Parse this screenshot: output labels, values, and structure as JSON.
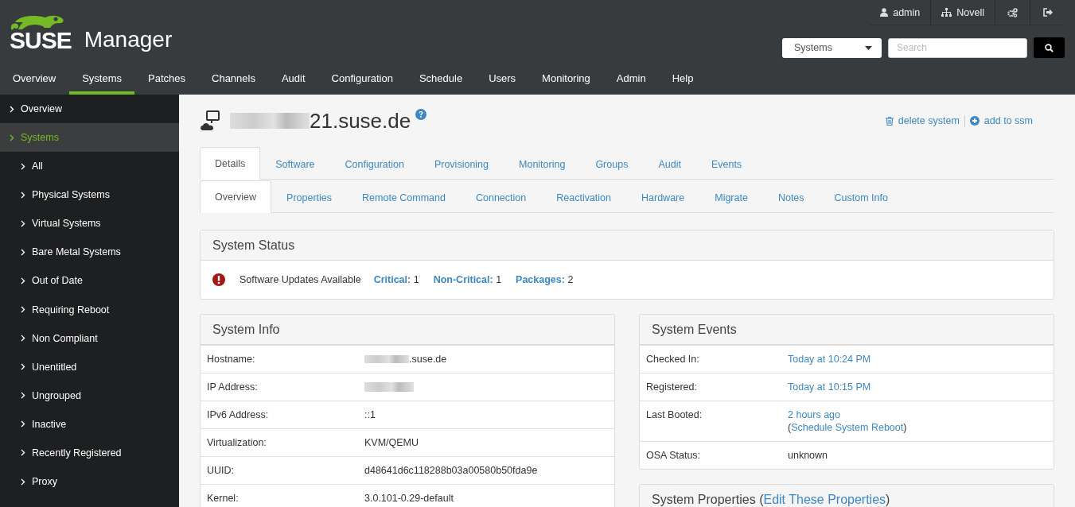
{
  "header": {
    "logo": {
      "brand": "SUSE",
      "product": "Manager"
    },
    "user_links": [
      {
        "kind": "user",
        "label": "admin"
      },
      {
        "kind": "org",
        "label": "Novell"
      },
      {
        "kind": "preferences"
      },
      {
        "kind": "logout"
      }
    ],
    "search": {
      "scope": "Systems",
      "placeholder": "Search"
    }
  },
  "nav": [
    {
      "label": "Overview",
      "selected": false
    },
    {
      "label": "Systems",
      "selected": true
    },
    {
      "label": "Patches",
      "selected": false
    },
    {
      "label": "Channels",
      "selected": false
    },
    {
      "label": "Audit",
      "selected": false
    },
    {
      "label": "Configuration",
      "selected": false
    },
    {
      "label": "Schedule",
      "selected": false
    },
    {
      "label": "Users",
      "selected": false
    },
    {
      "label": "Monitoring",
      "selected": false
    },
    {
      "label": "Admin",
      "selected": false
    },
    {
      "label": "Help",
      "selected": false
    }
  ],
  "sidebar": [
    {
      "label": "Overview",
      "selected": false
    },
    {
      "label": "Systems",
      "selected": true,
      "children": [
        {
          "label": "All",
          "selected": false
        },
        {
          "label": "Physical Systems",
          "selected": false
        },
        {
          "label": "Virtual Systems",
          "selected": false
        },
        {
          "label": "Bare Metal Systems",
          "selected": false
        },
        {
          "label": "Out of Date",
          "selected": false
        },
        {
          "label": "Requiring Reboot",
          "selected": false
        },
        {
          "label": "Non Compliant",
          "selected": false
        },
        {
          "label": "Unentitled",
          "selected": false
        },
        {
          "label": "Ungrouped",
          "selected": false
        },
        {
          "label": "Inactive",
          "selected": false
        },
        {
          "label": "Recently Registered",
          "selected": false
        },
        {
          "label": "Proxy",
          "selected": false
        }
      ]
    }
  ],
  "page": {
    "title": "21.suse.de",
    "redacted": true,
    "actions": [
      {
        "kind": "delete",
        "label": "delete system"
      },
      {
        "kind": "add",
        "label": "add to ssm"
      }
    ]
  },
  "tabs": [
    {
      "label": "Details",
      "selected": true
    },
    {
      "label": "Software",
      "selected": false
    },
    {
      "label": "Configuration",
      "selected": false
    },
    {
      "label": "Provisioning",
      "selected": false
    },
    {
      "label": "Monitoring",
      "selected": false
    },
    {
      "label": "Groups",
      "selected": false
    },
    {
      "label": "Audit",
      "selected": false
    },
    {
      "label": "Events",
      "selected": false
    }
  ],
  "subtabs": [
    {
      "label": "Overview",
      "selected": true
    },
    {
      "label": "Properties",
      "selected": false
    },
    {
      "label": "Remote Command",
      "selected": false
    },
    {
      "label": "Connection",
      "selected": false
    },
    {
      "label": "Reactivation",
      "selected": false
    },
    {
      "label": "Hardware",
      "selected": false
    },
    {
      "label": "Migrate",
      "selected": false
    },
    {
      "label": "Notes",
      "selected": false
    },
    {
      "label": "Custom Info",
      "selected": false
    }
  ],
  "system_status": {
    "title": "System Status",
    "message": "Software Updates Available",
    "counts": [
      {
        "label": "Critical:",
        "value": "1"
      },
      {
        "label": "Non-Critical:",
        "value": "1"
      },
      {
        "label": "Packages:",
        "value": "2"
      }
    ]
  },
  "system_info": {
    "title": "System Info",
    "rows": [
      {
        "label": "Hostname:",
        "value": ".suse.de",
        "redacted": true
      },
      {
        "label": "IP Address:",
        "redacted": true
      },
      {
        "label": "IPv6 Address:",
        "value": "::1",
        "redacted": false
      },
      {
        "label": "Virtualization:",
        "value": "KVM/QEMU",
        "redacted": false
      },
      {
        "label": "UUID:",
        "value": "d48641d6c118288b03a00580b50fda9e",
        "redacted": false
      },
      {
        "label": "Kernel:",
        "value": "3.0.101-0.29-default",
        "redacted": false
      }
    ]
  },
  "system_events": {
    "title": "System Events",
    "rows": [
      {
        "label": "Checked In:",
        "value": "Today at 10:24 PM",
        "link": true
      },
      {
        "label": "Registered:",
        "value": "Today at 10:15 PM",
        "link": true
      },
      {
        "label": "Last Booted:",
        "value": "2 hours ago",
        "link": true,
        "note": {
          "before": "(",
          "link": "Schedule System Reboot",
          "after": ")"
        }
      },
      {
        "label": "OSA Status:",
        "value": "unknown",
        "link": false
      }
    ]
  },
  "system_properties": {
    "title": "System Properties (",
    "link": "Edit These Properties",
    "after": ")"
  }
}
